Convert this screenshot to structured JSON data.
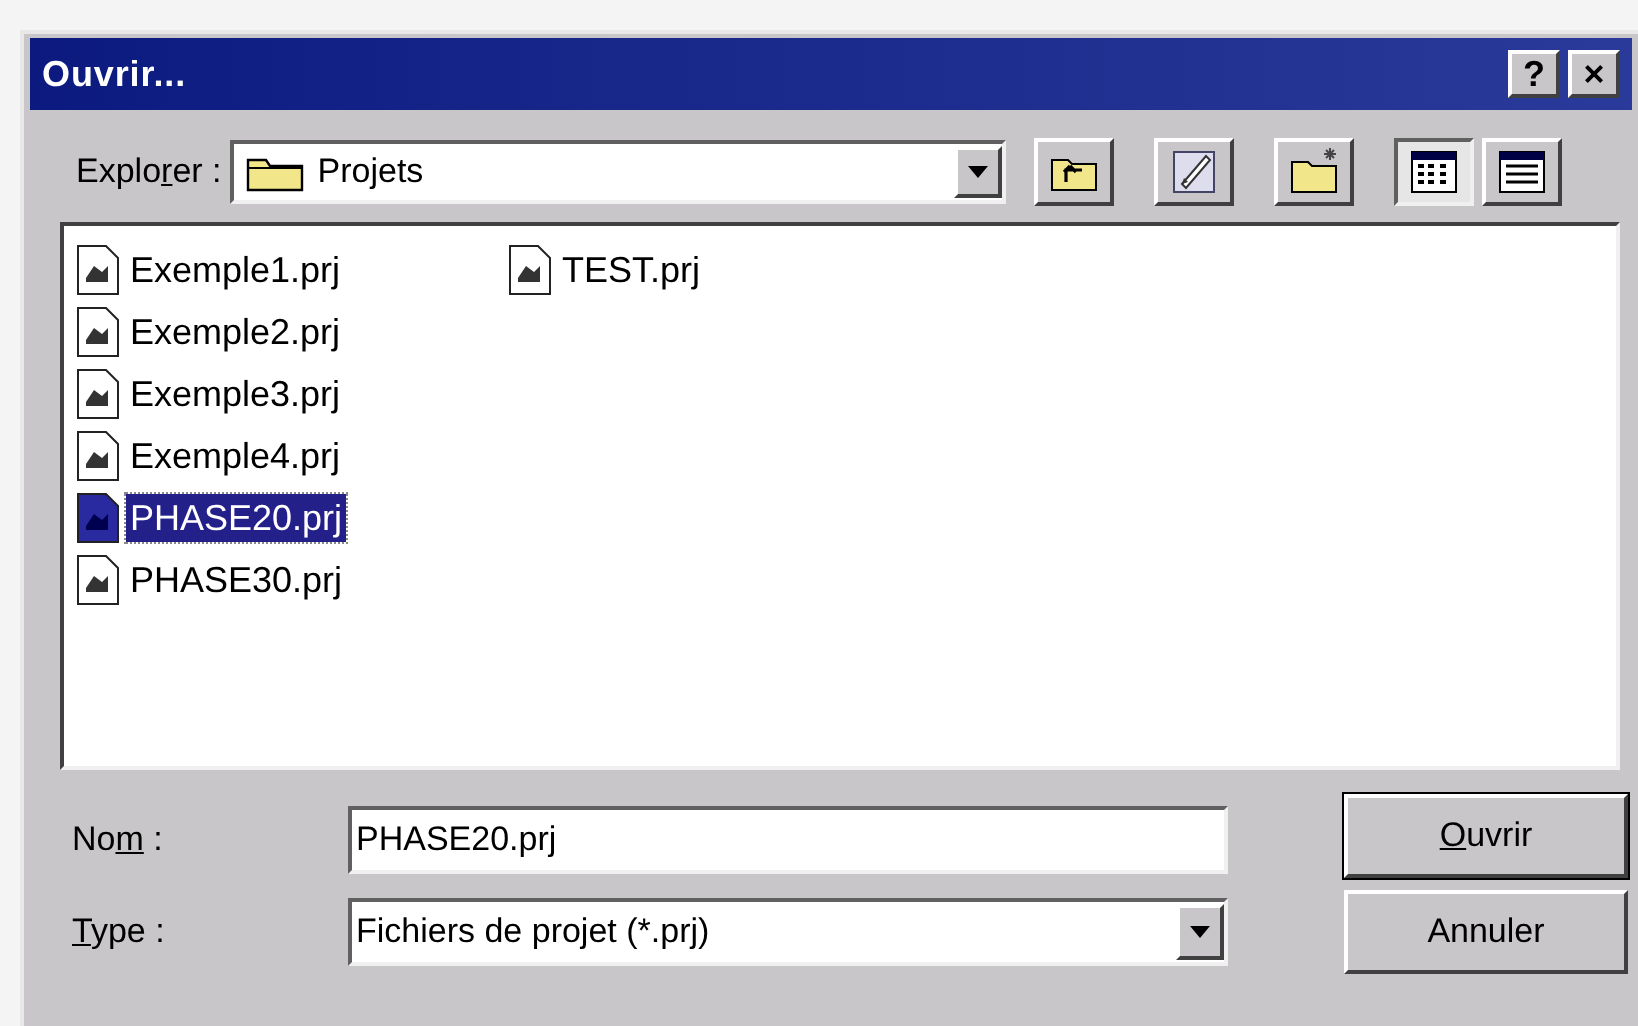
{
  "window": {
    "title": "Ouvrir..."
  },
  "title_buttons": [
    {
      "kind": "help",
      "label": "?"
    },
    {
      "kind": "close",
      "label": "×"
    }
  ],
  "look_in": {
    "label": {
      "before": "Explo",
      "key": "r",
      "after": "er :"
    },
    "value": "Projets"
  },
  "toolbar": [
    {
      "kind": "up",
      "selected": false
    },
    {
      "kind": "desktop",
      "selected": false
    },
    {
      "kind": "new-folder",
      "selected": false
    },
    {
      "kind": "list",
      "selected": true
    },
    {
      "kind": "details",
      "selected": false
    }
  ],
  "files": [
    {
      "name": "Exemple1.prj",
      "selected": false
    },
    {
      "name": "Exemple2.prj",
      "selected": false
    },
    {
      "name": "Exemple3.prj",
      "selected": false
    },
    {
      "name": "Exemple4.prj",
      "selected": false
    },
    {
      "name": "PHASE20.prj",
      "selected": true
    },
    {
      "name": "PHASE30.prj",
      "selected": false
    },
    {
      "name": "TEST.prj",
      "selected": false
    }
  ],
  "file_name": {
    "label": {
      "before": "No",
      "key": "m",
      "after": " :"
    },
    "value": "PHASE20.prj"
  },
  "file_type": {
    "label": {
      "key": "T",
      "after": "ype :"
    },
    "value": "Fichiers de projet (*.prj)"
  },
  "buttons": [
    {
      "label": {
        "key": "O",
        "after": "uvrir"
      },
      "default": true
    },
    {
      "label": {
        "before": "Annuler"
      },
      "default": false
    }
  ]
}
